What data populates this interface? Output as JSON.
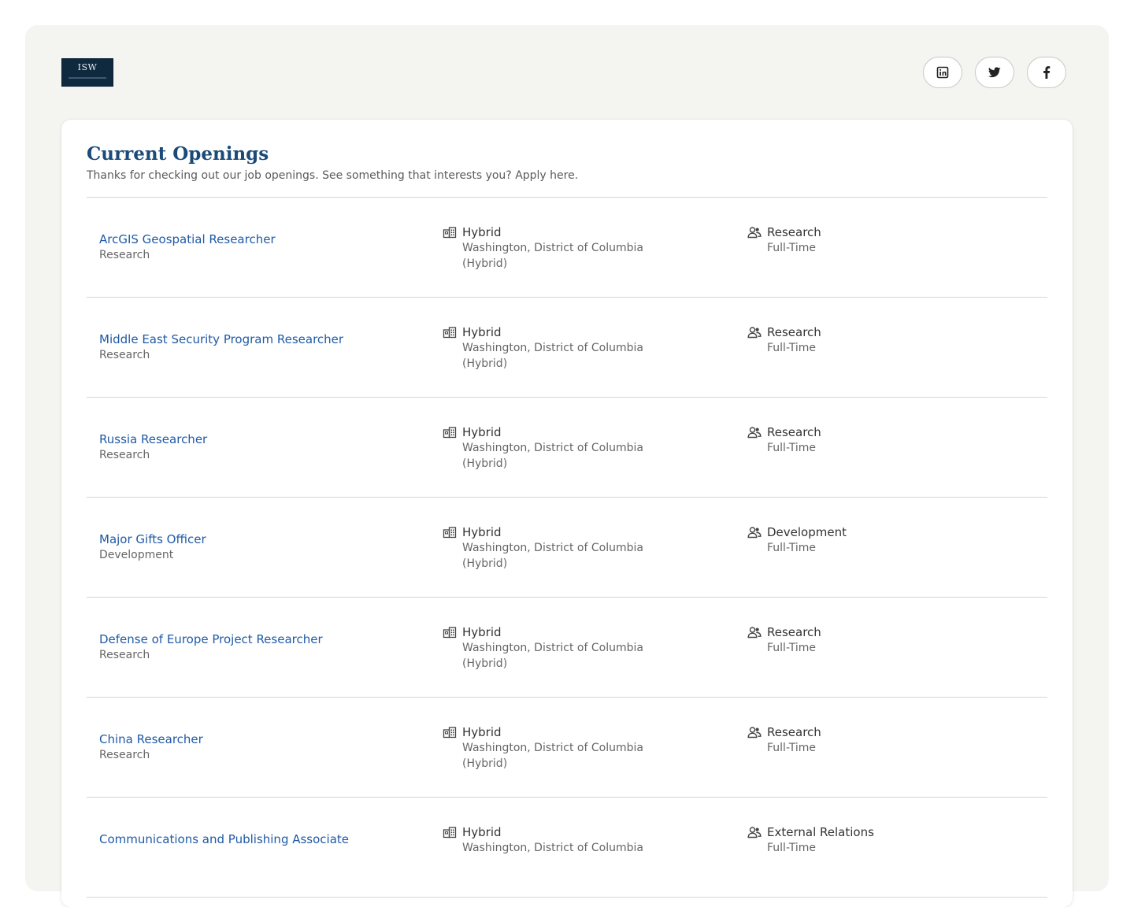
{
  "header": {
    "logo_text": "ISW",
    "socials": [
      {
        "name": "linkedin",
        "icon": "linkedin-icon"
      },
      {
        "name": "twitter",
        "icon": "twitter-icon"
      },
      {
        "name": "facebook",
        "icon": "facebook-icon"
      }
    ]
  },
  "main": {
    "title": "Current Openings",
    "intro": "Thanks for checking out our job openings. See something that interests you? Apply here.",
    "jobs": [
      {
        "title": "ArcGIS Geospatial Researcher",
        "department": "Research",
        "work_type": "Hybrid",
        "location": "Washington, District of Columbia",
        "location_note": "(Hybrid)",
        "team": "Research",
        "employment": "Full-Time"
      },
      {
        "title": "Middle East Security Program Researcher",
        "department": "Research",
        "work_type": "Hybrid",
        "location": "Washington, District of Columbia",
        "location_note": "(Hybrid)",
        "team": "Research",
        "employment": "Full-Time"
      },
      {
        "title": "Russia Researcher",
        "department": "Research",
        "work_type": "Hybrid",
        "location": "Washington, District of Columbia",
        "location_note": "(Hybrid)",
        "team": "Research",
        "employment": "Full-Time"
      },
      {
        "title": "Major Gifts Officer",
        "department": "Development",
        "work_type": "Hybrid",
        "location": "Washington, District of Columbia",
        "location_note": "(Hybrid)",
        "team": "Development",
        "employment": "Full-Time"
      },
      {
        "title": "Defense of Europe Project Researcher",
        "department": "Research",
        "work_type": "Hybrid",
        "location": "Washington, District of Columbia",
        "location_note": "(Hybrid)",
        "team": "Research",
        "employment": "Full-Time"
      },
      {
        "title": "China Researcher",
        "department": "Research",
        "work_type": "Hybrid",
        "location": "Washington, District of Columbia",
        "location_note": "(Hybrid)",
        "team": "Research",
        "employment": "Full-Time"
      },
      {
        "title": "Communications and Publishing Associate",
        "department": "",
        "work_type": "Hybrid",
        "location": "Washington, District of Columbia",
        "location_note": "",
        "team": "External Relations",
        "employment": "Full-Time"
      }
    ]
  }
}
